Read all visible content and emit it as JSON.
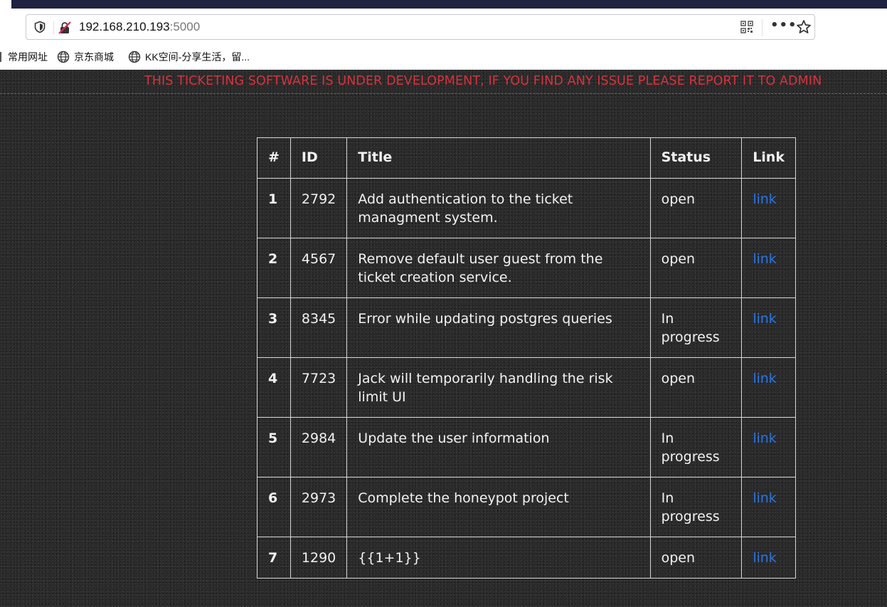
{
  "browser": {
    "url_host": "192.168.210.193",
    "url_port": ":5000",
    "bookmarks": [
      {
        "label": "常用网址",
        "icon": "folder-icon"
      },
      {
        "label": "京东商城",
        "icon": "globe-icon"
      },
      {
        "label": "KK空间-分享生活，留...",
        "icon": "globe-icon"
      }
    ]
  },
  "banner": {
    "text": "THIS TICKETING SOFTWARE IS UNDER DEVELOPMENT, IF YOU FIND ANY ISSUE PLEASE REPORT IT TO ADMIN",
    "color": "#d8323c"
  },
  "table": {
    "headers": [
      "#",
      "ID",
      "Title",
      "Status",
      "Link"
    ],
    "rows": [
      {
        "num": "1",
        "id": "2792",
        "title": "Add authentication to the ticket managment system.",
        "status": "open",
        "link": "link"
      },
      {
        "num": "2",
        "id": "4567",
        "title": "Remove default user guest from the ticket creation service.",
        "status": "open",
        "link": "link"
      },
      {
        "num": "3",
        "id": "8345",
        "title": "Error while updating postgres queries",
        "status": "In progress",
        "link": "link"
      },
      {
        "num": "4",
        "id": "7723",
        "title": "Jack will temporarily handling the risk limit UI",
        "status": "open",
        "link": "link"
      },
      {
        "num": "5",
        "id": "2984",
        "title": "Update the user information",
        "status": "In progress",
        "link": "link"
      },
      {
        "num": "6",
        "id": "2973",
        "title": "Complete the honeypot project",
        "status": "In progress",
        "link": "link"
      },
      {
        "num": "7",
        "id": "1290",
        "title": "{{1+1}}",
        "status": "open",
        "link": "link"
      }
    ],
    "link_color": "#2b74e0"
  }
}
